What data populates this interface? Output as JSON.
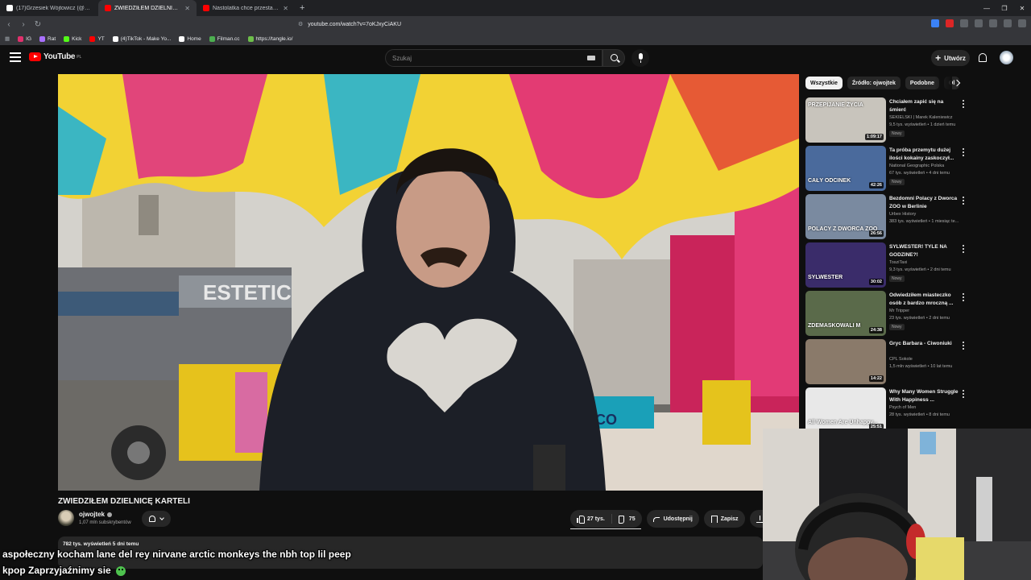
{
  "browser": {
    "tabs": [
      {
        "label": "(17)Grzesiek Wójtowicz (@grzesiek...",
        "favicon_color": "#ffffff"
      },
      {
        "label": "ZWIEDZIŁEM DZIELNICĘ KAR...",
        "favicon_color": "#ff0000",
        "active": true
      },
      {
        "label": "Nastolatka chce przestać pić - YouTu...",
        "favicon_color": "#ff0000"
      }
    ],
    "new_tab": "+",
    "url": "youtube.com/watch?v=7oKJxyCiAKU",
    "bookmarks": [
      {
        "label": "IG",
        "color": "#e1306c"
      },
      {
        "label": "Rat",
        "color": "#a970ff"
      },
      {
        "label": "Kick",
        "color": "#53fc18"
      },
      {
        "label": "YT",
        "color": "#ff0000"
      },
      {
        "label": "(4)TikTok - Make Yo...",
        "color": "#ffffff"
      },
      {
        "label": "Home",
        "color": "#ffffff"
      },
      {
        "label": "Filman.cc",
        "color": "#4caf50"
      },
      {
        "label": "https://tangle.io/",
        "color": "#6dbf4a"
      }
    ]
  },
  "youtube": {
    "logo_text": "YouTube",
    "logo_region": "PL",
    "search_placeholder": "Szukaj",
    "create_label": "Utwórz"
  },
  "video": {
    "title": "ZWIEDZIŁEM DZIELNICĘ KARTELI",
    "channel": "ojwojtek",
    "subscribers": "1,07 mln subskrybentów",
    "likes": "27 tys.",
    "dislikes": "75",
    "share_label": "Udostępnij",
    "save_label": "Zapisz",
    "download_label": "Po",
    "views_meta": "782 tys. wyświetleń  5 dni temu"
  },
  "sidebar": {
    "chips": [
      "Wszystkie",
      "Źródło: ojwojtek",
      "Podobne",
      "Ol"
    ],
    "recommendations": [
      {
        "title": "Chciałem zapić się na śmierć",
        "channel": "SEKIELSKI  | Marek Kaleniewicz",
        "meta": "9,5 tys. wyświetleń • 1 dzień temu",
        "badge": "Nowy",
        "duration": "1:09:17",
        "thumb_text": "PRZEPIJANIE ŻYCIA",
        "thumb_color": "#c8c4bc"
      },
      {
        "title": "Ta próba przemytu dużej ilości kokainy zaskoczył...",
        "channel": "National Geographic Polska",
        "meta": "67 tys. wyświetleń • 4 dni temu",
        "badge": "Nowy",
        "duration": "42:26",
        "thumb_text": "CAŁY ODCINEK",
        "thumb_color": "#4a6a9c"
      },
      {
        "title": "Bezdomni Polacy z Dworca ZOO w Berlinie",
        "channel": "Urbex History",
        "meta": "383 tys. wyświetleń • 1 miesiąc te...",
        "badge": "",
        "duration": "26:56",
        "thumb_text": "POLACY Z DWORCA ZOO",
        "thumb_color": "#7a8aa0"
      },
      {
        "title": "SYLWESTER! TYLE NA GODZINE?!",
        "channel": "TosziTaxi",
        "meta": "9,3 tys. wyświetleń • 2 dni temu",
        "badge": "Nowy",
        "duration": "30:02",
        "thumb_text": "SYLWESTER",
        "thumb_color": "#3a2c6a"
      },
      {
        "title": "Odwiedziłem miasteczko osób z bardzo mroczną ...",
        "channel": "Mr Tripper",
        "meta": "23 tys. wyświetleń • 2 dni temu",
        "badge": "Nowy",
        "duration": "24:38",
        "thumb_text": "ZDEMASKOWALI M",
        "thumb_color": "#5a6a4a"
      },
      {
        "title": "Gryc Barbara - Ciwoniuki",
        "channel": "CPL Sokole",
        "meta": "1,5 mln wyświetleń • 10 lat temu",
        "badge": "",
        "duration": "14:22",
        "thumb_text": "",
        "thumb_color": "#8a7a6a"
      },
      {
        "title": "Why Many Women Struggle With Happiness ...",
        "channel": "Psych of Men",
        "meta": "28 tys. wyświetleń • 8 dni temu",
        "badge": "",
        "duration": "25:51",
        "thumb_text": "All Women Are Unhappy...",
        "thumb_color": "#e8e8e8"
      }
    ]
  },
  "overlay": {
    "chat_line_1": "aspołeczny kocham lane del rey nirvane arctic monkeys the nbh top lil peep",
    "chat_line_2": "kpop Zaprzyjaźnimy sie"
  }
}
